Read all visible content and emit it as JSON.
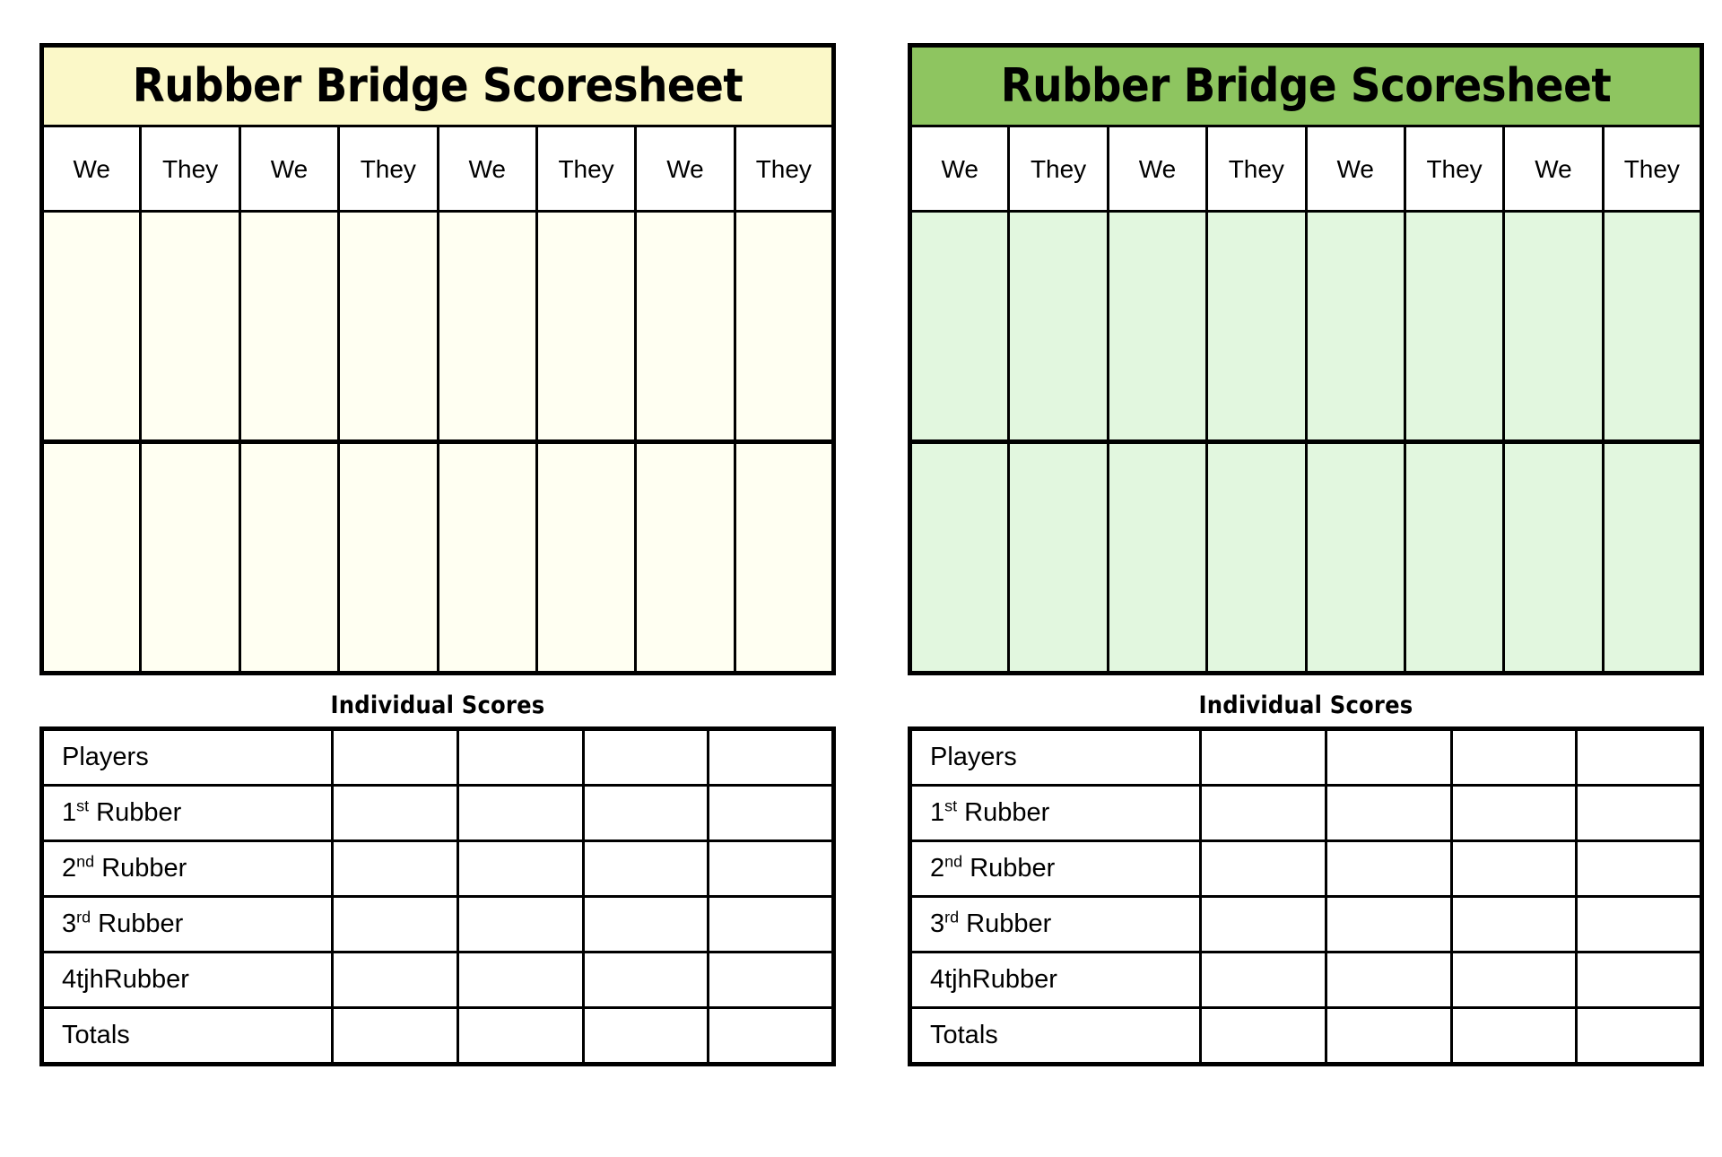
{
  "sheets": [
    {
      "id": "yellow",
      "title": "Rubber Bridge Scoresheet",
      "title_bg": "#FBF8C8",
      "body_bg": "#FFFFF2",
      "columns": [
        "We",
        "They",
        "We",
        "They",
        "We",
        "They",
        "We",
        "They"
      ],
      "body_rows": 2,
      "caption": "Individual Scores",
      "individual": {
        "rows": [
          {
            "label": "Players",
            "sup": "",
            "label_tail": ""
          },
          {
            "label": "1",
            "sup": "st",
            "label_tail": " Rubber"
          },
          {
            "label": "2",
            "sup": "nd",
            "label_tail": " Rubber"
          },
          {
            "label": "3",
            "sup": "rd",
            "label_tail": " Rubber"
          },
          {
            "label": "4tjhRubber",
            "sup": "",
            "label_tail": ""
          },
          {
            "label": "Totals",
            "sup": "",
            "label_tail": ""
          }
        ],
        "player_columns": 4
      }
    },
    {
      "id": "green",
      "title": "Rubber Bridge Scoresheet",
      "title_bg": "#8EC560",
      "body_bg": "#E2F7DF",
      "columns": [
        "We",
        "They",
        "We",
        "They",
        "We",
        "They",
        "We",
        "They"
      ],
      "body_rows": 2,
      "caption": "Individual Scores",
      "individual": {
        "rows": [
          {
            "label": "Players",
            "sup": "",
            "label_tail": ""
          },
          {
            "label": "1",
            "sup": "st",
            "label_tail": " Rubber"
          },
          {
            "label": "2",
            "sup": "nd",
            "label_tail": " Rubber"
          },
          {
            "label": "3",
            "sup": "rd",
            "label_tail": " Rubber"
          },
          {
            "label": "4tjhRubber",
            "sup": "",
            "label_tail": ""
          },
          {
            "label": "Totals",
            "sup": "",
            "label_tail": ""
          }
        ],
        "player_columns": 4
      }
    }
  ]
}
